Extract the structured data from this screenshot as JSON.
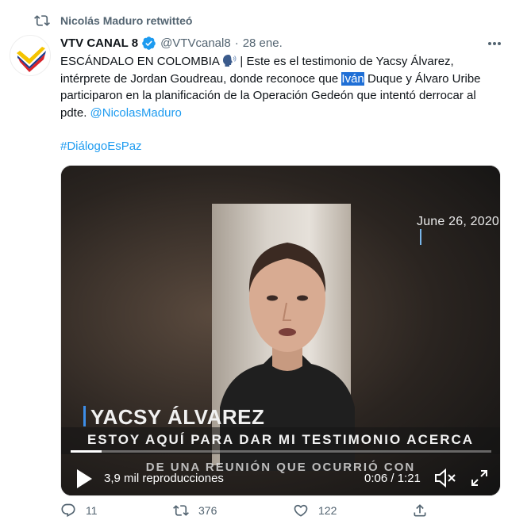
{
  "retweet_header": {
    "text": "Nicolás Maduro retwitteó"
  },
  "tweet": {
    "author_name": "VTV CANAL 8",
    "handle": "@VTVcanal8",
    "separator": "·",
    "time": "28 ene.",
    "text_part1": "ESCÁNDALO EN COLOMBIA ",
    "text_part2": " | Este es el testimonio de Yacsy Álvarez, intérprete de Jordan Goudreau, donde reconoce que ",
    "text_highlighted": "Iván",
    "text_part3": " Duque y Álvaro Uribe participaron en la planificación de la Operación Gedeón que intentó derrocar al pdte. ",
    "mention": "@NicolasMaduro",
    "hashtag": "#DiálogoEsPaz"
  },
  "video": {
    "date_overlay": "June 26, 2020",
    "name_overlay": "YACSY ÁLVAREZ",
    "subtitle_line1": "ESTOY AQUÍ PARA DAR MI TESTIMONIO ACERCA",
    "subtitle_line2": "DE UNA REUNIÓN QUE OCURRIÓ CON",
    "views": "3,9 mil reproducciones",
    "time": "0:06 / 1:21",
    "progress_fraction": 0.074
  },
  "actions": {
    "replies": "11",
    "retweets": "376",
    "likes": "122"
  },
  "colors": {
    "accent": "#1d9bf0",
    "muted_text": "#536471",
    "highlight": "#1f6fd6"
  }
}
